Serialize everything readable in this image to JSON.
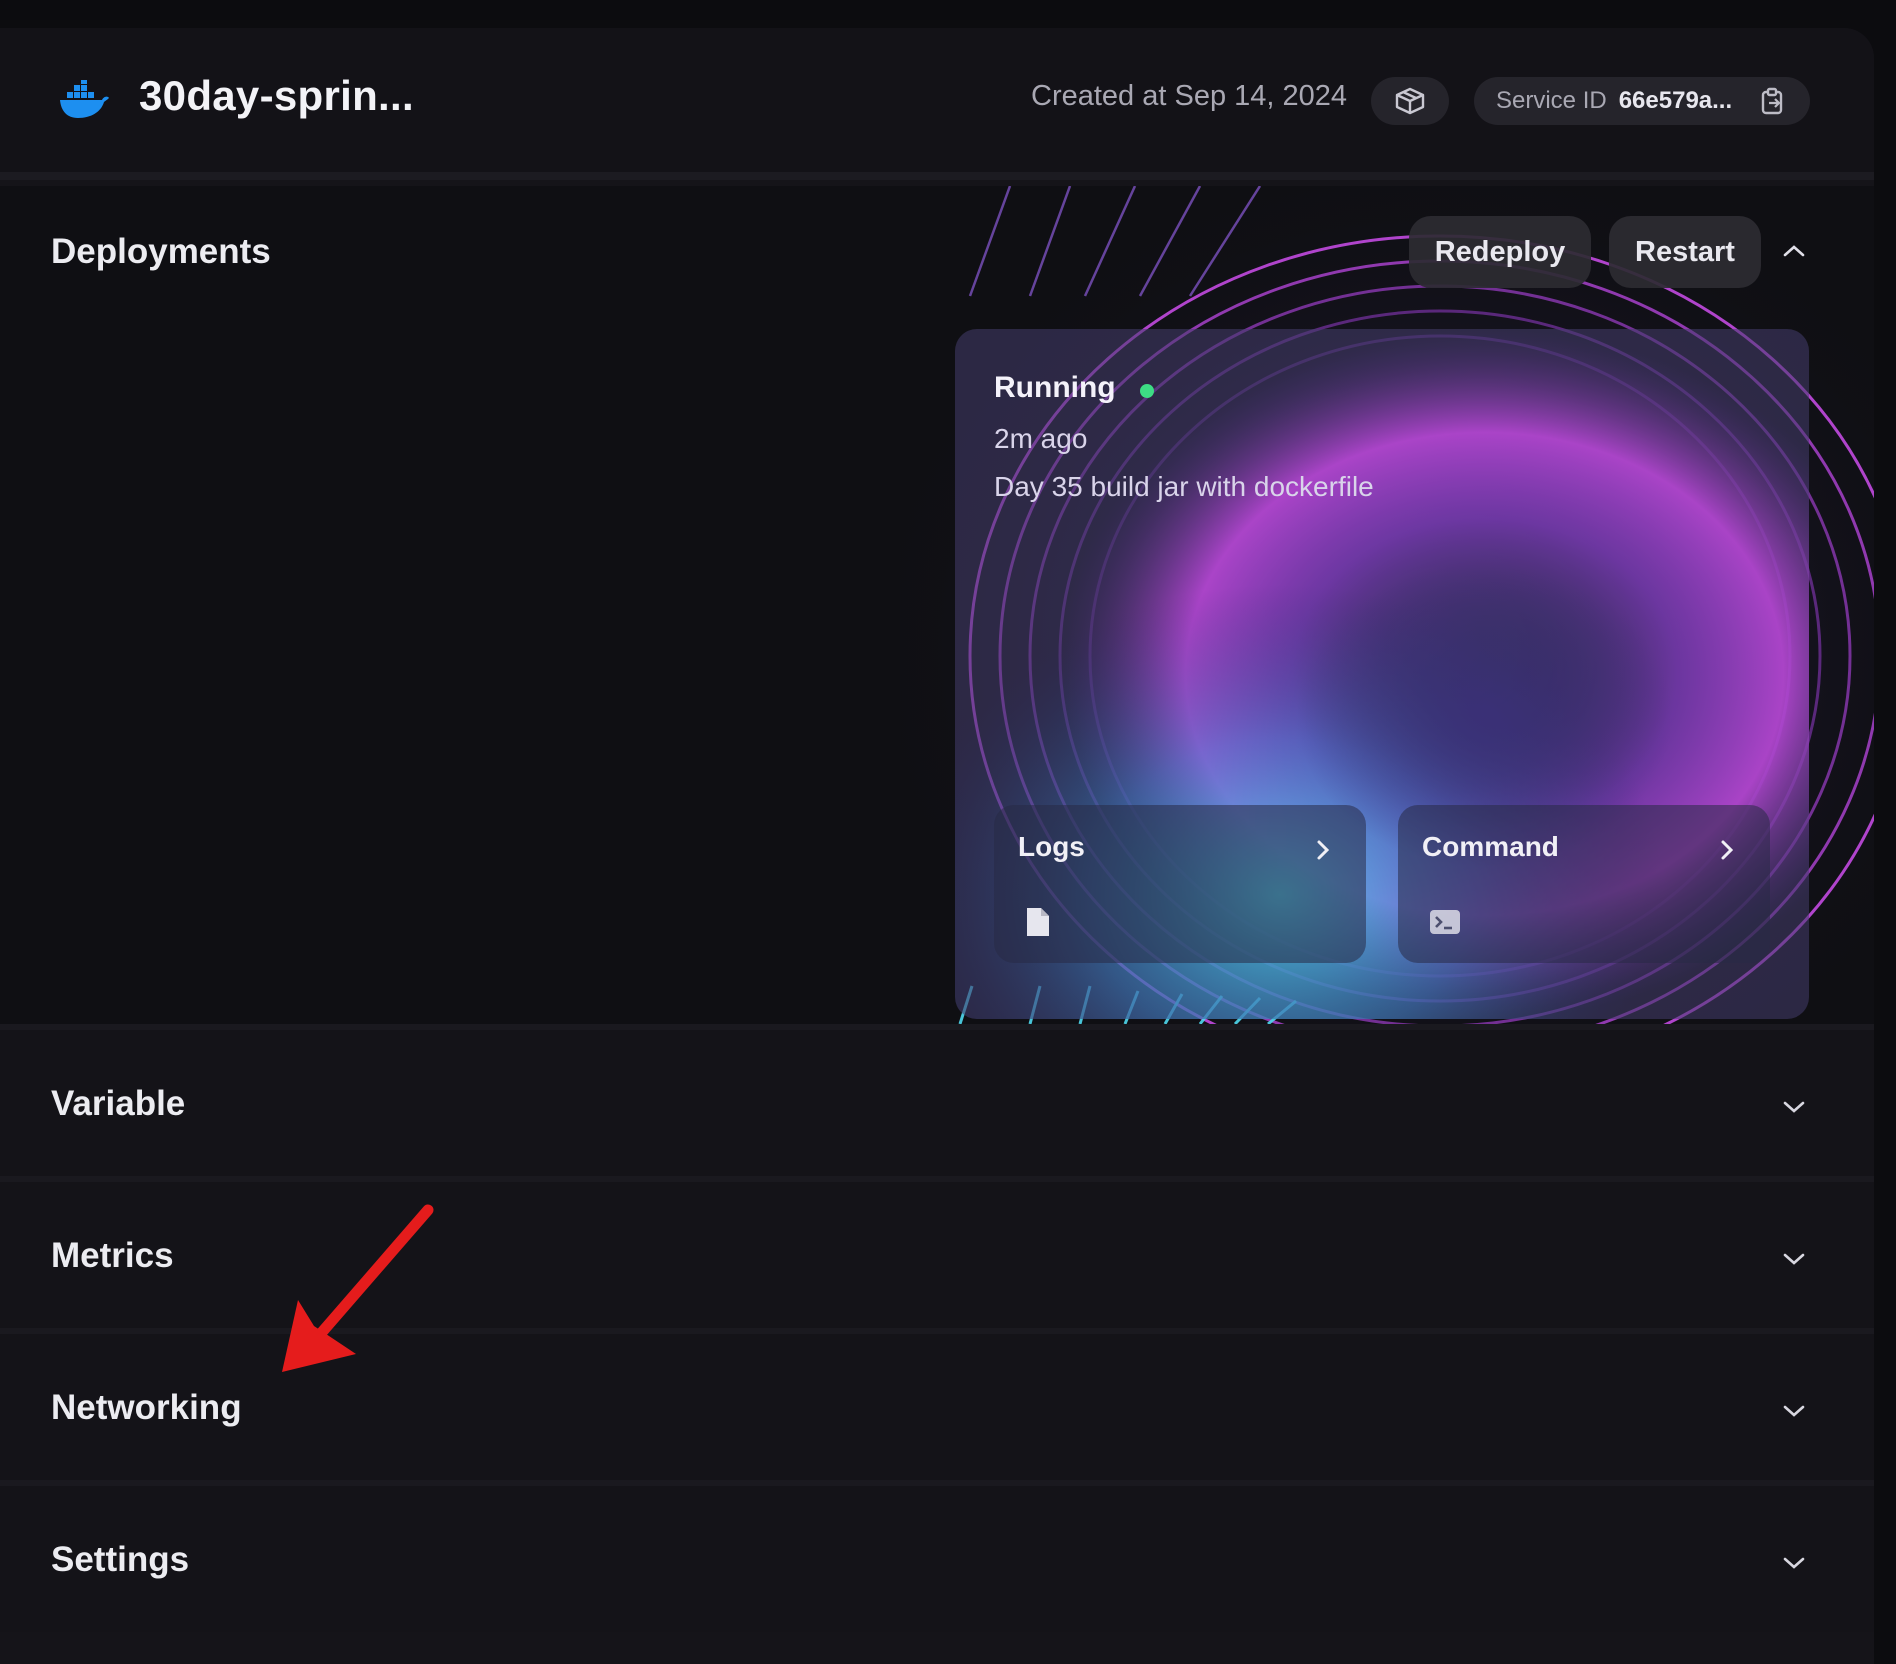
{
  "header": {
    "service_name": "30day-sprin...",
    "created_at": "Created at Sep 14, 2024",
    "service_id_label": "Service ID",
    "service_id_value": "66e579a..."
  },
  "deployments": {
    "title": "Deployments",
    "redeploy_label": "Redeploy",
    "restart_label": "Restart",
    "card": {
      "status": "Running",
      "status_color": "#3ddc84",
      "time_ago": "2m ago",
      "commit_message": "Day 35 build jar with dockerfile",
      "logs_label": "Logs",
      "command_label": "Command"
    }
  },
  "sections": {
    "variable": "Variable",
    "metrics": "Metrics",
    "networking": "Networking",
    "settings": "Settings"
  },
  "colors": {
    "accent_magenta": "#d24cf0",
    "accent_cyan": "#4fd8ee",
    "docker_blue": "#1d8ff0",
    "annotation_red": "#e51c1c"
  },
  "icons": [
    "docker-logo-icon",
    "package-icon",
    "copy-icon",
    "chevron-up-icon",
    "chevron-right-icon",
    "document-icon",
    "terminal-icon",
    "chevron-down-icon"
  ]
}
